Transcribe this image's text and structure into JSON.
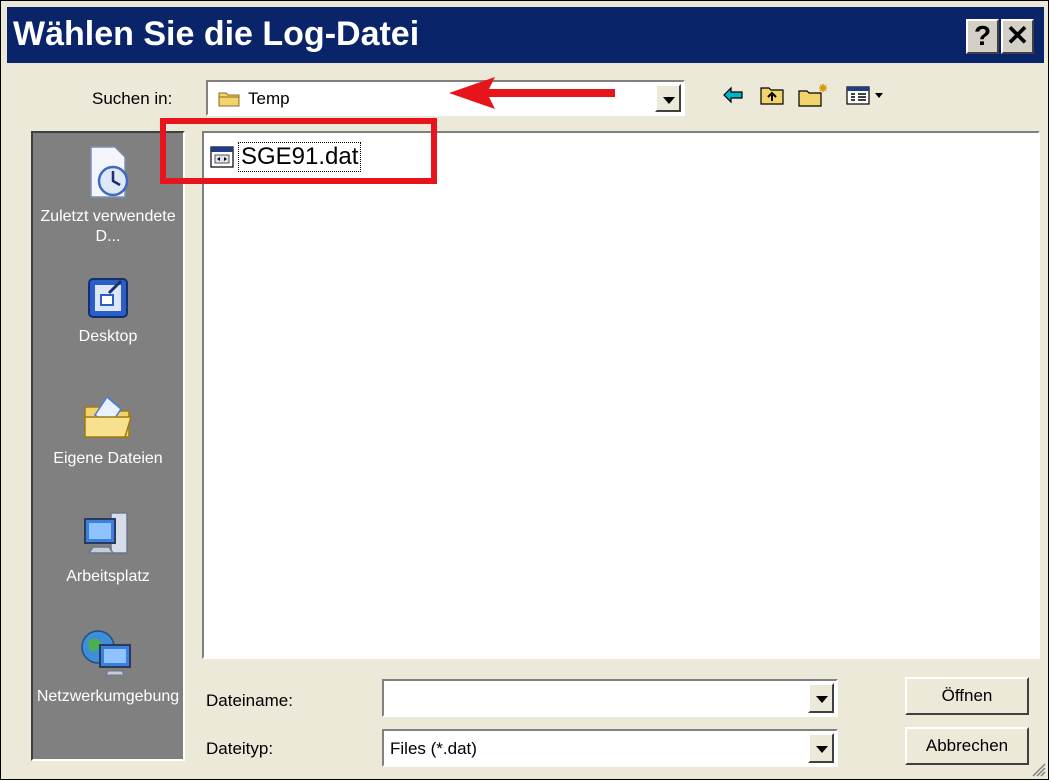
{
  "window": {
    "title": "Wählen Sie die Log-Datei",
    "help_button": "?",
    "close_button": "✕"
  },
  "look_in": {
    "label": "Suchen in:",
    "value": "Temp"
  },
  "toolbar": {
    "icons": [
      "back-arrow-icon",
      "up-folder-icon",
      "new-folder-icon",
      "view-menu-icon"
    ]
  },
  "places": [
    {
      "label": "Zuletzt verwendete D...",
      "icon": "recent-documents-icon"
    },
    {
      "label": "Desktop",
      "icon": "desktop-icon"
    },
    {
      "label": "Eigene Dateien",
      "icon": "my-documents-icon"
    },
    {
      "label": "Arbeitsplatz",
      "icon": "my-computer-icon"
    },
    {
      "label": "Netzwerkumgebung",
      "icon": "network-icon"
    }
  ],
  "files": [
    {
      "name": "SGE91.dat",
      "icon": "dat-file-icon"
    }
  ],
  "filename_field": {
    "label": "Dateiname:",
    "value": ""
  },
  "filetype_field": {
    "label": "Dateityp:",
    "value": "Files (*.dat)"
  },
  "buttons": {
    "open": "Öffnen",
    "cancel": "Abbrechen"
  },
  "annotation_colors": {
    "highlight": "#e8141b",
    "titlebar": "#0a246a"
  }
}
